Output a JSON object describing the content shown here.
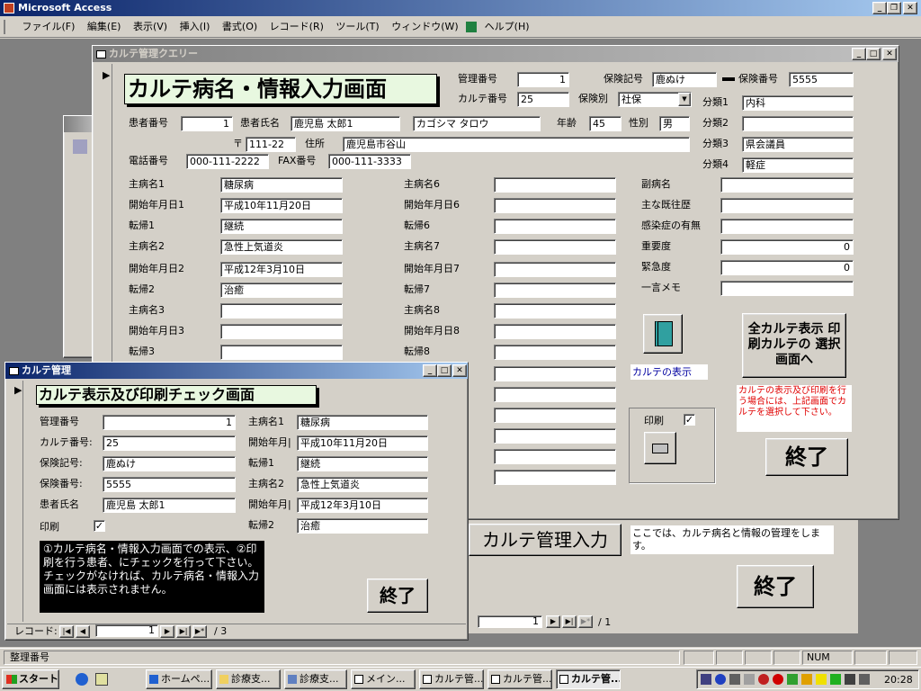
{
  "app": {
    "title": "Microsoft Access"
  },
  "menu": [
    "ファイル(F)",
    "編集(E)",
    "表示(V)",
    "挿入(I)",
    "書式(O)",
    "レコード(R)",
    "ツール(T)",
    "ウィンドウ(W)",
    "ヘルプ(H)"
  ],
  "status": {
    "left": "整理番号",
    "num": "NUM"
  },
  "backform": {
    "button_label": "カルテ管理入力",
    "description": "ここでは、カルテ病名と情報の管理をします。",
    "end_label": "終了",
    "nav_record": "1",
    "nav_total": "/ 1"
  },
  "mainform": {
    "title": "カルテ管理クエリー",
    "heading": "カルテ病名・情報入力画面",
    "labels": {
      "kanri": "管理番号",
      "karte": "カルテ番号",
      "hoken_kigo": "保険記号",
      "hoken_bangou": "保険番号",
      "hoken_betsu": "保険別",
      "bunrui1": "分類1",
      "bunrui2": "分類2",
      "bunrui3": "分類3",
      "bunrui4": "分類4",
      "kanja_no": "患者番号",
      "kanja_name": "患者氏名",
      "nenrei": "年齢",
      "seibetsu": "性別",
      "postal": "〒",
      "address": "住所",
      "tel": "電話番号",
      "fax": "FAX番号"
    },
    "values": {
      "kanri": "1",
      "karte": "25",
      "hoken_kigo": "鹿ぬけ",
      "hoken_bangou": "5555",
      "hoken_betsu": "社保",
      "bunrui1": "内科",
      "bunrui2": "",
      "bunrui3": "県会議員",
      "bunrui4": "軽症",
      "kanja_no": "1",
      "kanja_name": "鹿児島 太郎1",
      "kana": "カゴシマ タロウ",
      "nenrei": "45",
      "seibetsu": "男",
      "postal": "111-22",
      "address": "鹿児島市谷山",
      "tel": "000-111-2222",
      "fax": "000-111-3333"
    },
    "col1": [
      {
        "label": "主病名1",
        "value": "糖尿病"
      },
      {
        "label": "開始年月日1",
        "value": "平成10年11月20日"
      },
      {
        "label": "転帰1",
        "value": "継続"
      },
      {
        "label": "主病名2",
        "value": "急性上気道炎"
      },
      {
        "label": "開始年月日2",
        "value": "平成12年3月10日"
      },
      {
        "label": "転帰2",
        "value": "治癒"
      },
      {
        "label": "主病名3",
        "value": ""
      },
      {
        "label": "開始年月日3",
        "value": ""
      },
      {
        "label": "転帰3",
        "value": ""
      }
    ],
    "col2": [
      {
        "label": "主病名6",
        "value": ""
      },
      {
        "label": "開始年月日6",
        "value": ""
      },
      {
        "label": "転帰6",
        "value": ""
      },
      {
        "label": "主病名7",
        "value": ""
      },
      {
        "label": "開始年月日7",
        "value": ""
      },
      {
        "label": "転帰7",
        "value": ""
      },
      {
        "label": "主病名8",
        "value": ""
      },
      {
        "label": "開始年月日8",
        "value": ""
      },
      {
        "label": "転帰8",
        "value": ""
      }
    ],
    "col3": [
      {
        "label": "副病名",
        "value": ""
      },
      {
        "label": "主な既往歴",
        "value": ""
      },
      {
        "label": "感染症の有無",
        "value": ""
      },
      {
        "label": "重要度",
        "value": "0"
      },
      {
        "label": "緊急度",
        "value": "0"
      },
      {
        "label": "一言メモ",
        "value": ""
      }
    ],
    "karte_hyouji": "カルテの表示",
    "all_karte_button": "全カルテ表示 印刷カルテの 選択画面へ",
    "red_note": "カルテの表示及び印刷を行う場合には、上記画面でカルテを選択して下さい。",
    "print_label": "印刷",
    "print_checked": "✓",
    "end_label": "終了"
  },
  "subform": {
    "title": "カルテ管理",
    "heading": "カルテ表示及び印刷チェック画面",
    "left": [
      {
        "label": "管理番号",
        "value": "1"
      },
      {
        "label": "カルテ番号:",
        "value": "25"
      },
      {
        "label": "保険記号:",
        "value": "鹿ぬけ"
      },
      {
        "label": "保険番号:",
        "value": "5555"
      },
      {
        "label": "患者氏名",
        "value": "鹿児島 太郎1"
      }
    ],
    "right": [
      {
        "label": "主病名1",
        "value": "糖尿病"
      },
      {
        "label": "開始年月|",
        "value": "平成10年11月20日"
      },
      {
        "label": "転帰1",
        "value": "継続"
      },
      {
        "label": "主病名2",
        "value": "急性上気道炎"
      },
      {
        "label": "開始年月|",
        "value": "平成12年3月10日"
      },
      {
        "label": "転帰2",
        "value": "治癒"
      }
    ],
    "print_label": "印刷",
    "print_checked": "✓",
    "note": "①カルテ病名・情報入力画面での表示、②印刷を行う患者、にチェックを行って下さい。チェックがなければ、カルテ病名・情報入力画面には表示されません。",
    "end_label": "終了",
    "nav_label": "レコード:",
    "nav_record": "1",
    "nav_total": "/ 3"
  },
  "taskbar": {
    "start": "スタート",
    "tasks": [
      "ホームペ...",
      "診療支...",
      "診療支...",
      "メイン...",
      "カルテ管...",
      "カルテ管...",
      "カルテ管..."
    ],
    "clock": "20:28"
  }
}
